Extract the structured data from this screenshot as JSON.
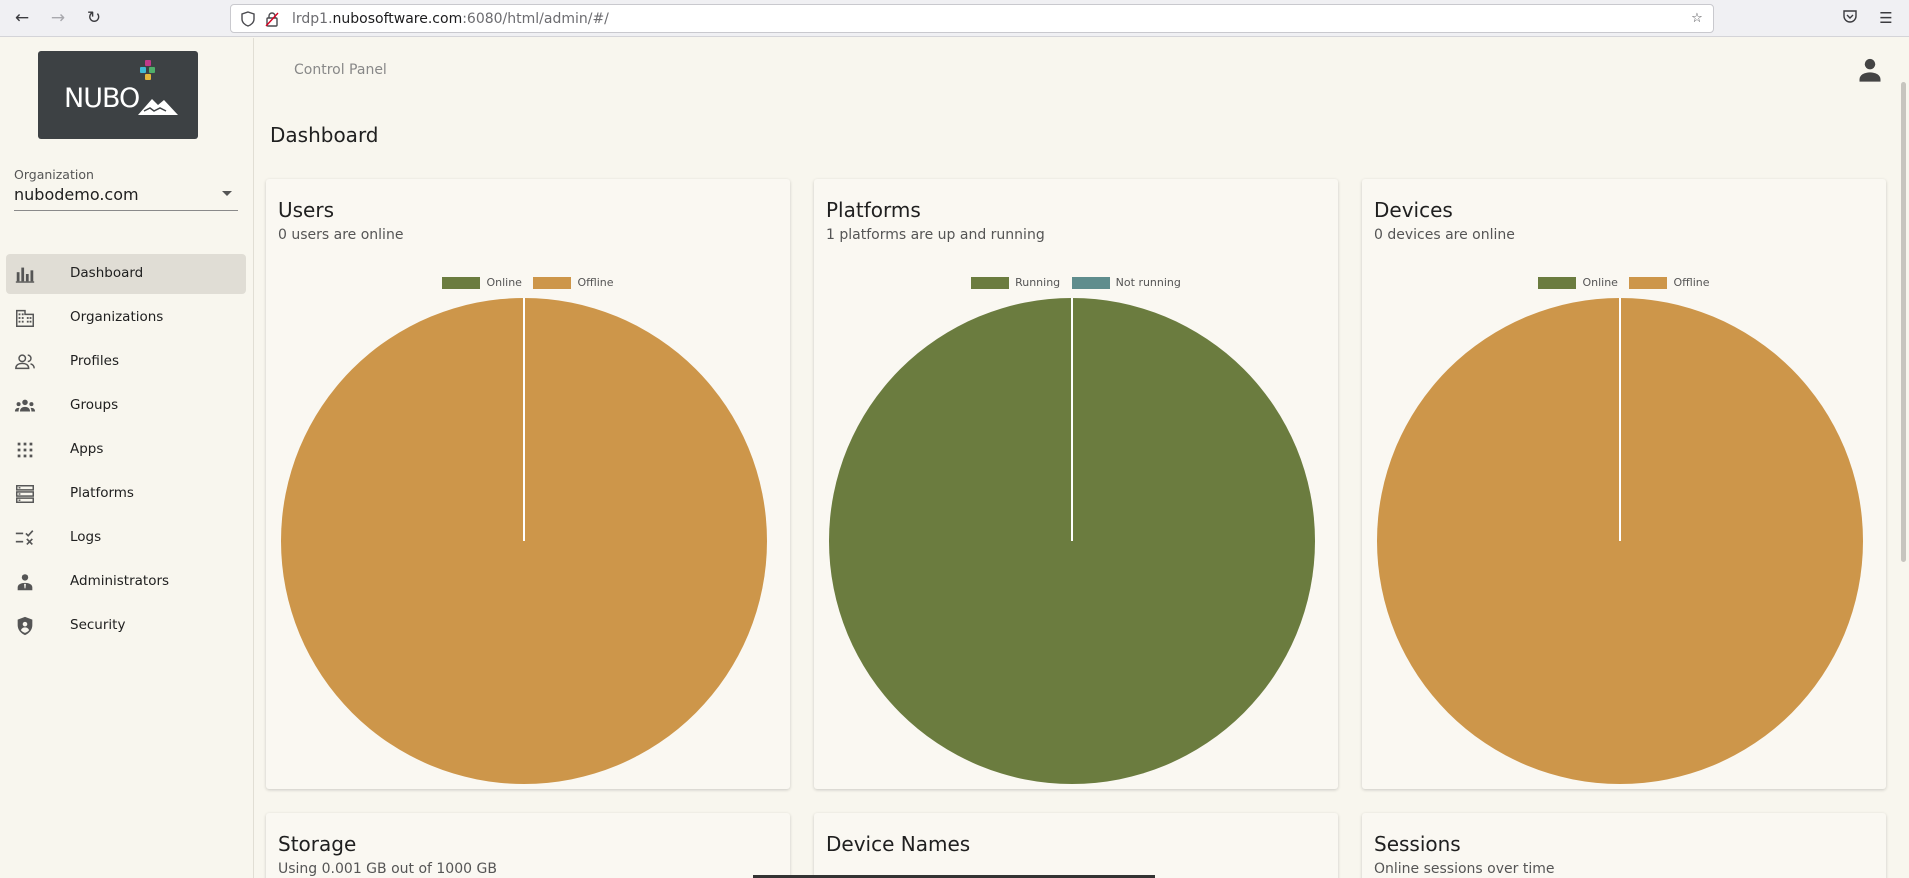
{
  "browser": {
    "url_host_prefix": "lrdp1.",
    "url_host": "nubosoftware.com",
    "url_rest": ":6080/html/admin/#/"
  },
  "sidebar": {
    "logo_text": "NUBO",
    "org_label": "Organization",
    "org_value": "nubodemo.com",
    "items": [
      {
        "label": "Dashboard",
        "icon": "bar-chart-icon",
        "active": true
      },
      {
        "label": "Organizations",
        "icon": "building-icon"
      },
      {
        "label": "Profiles",
        "icon": "people-icon"
      },
      {
        "label": "Groups",
        "icon": "groups-icon"
      },
      {
        "label": "Apps",
        "icon": "apps-grid-icon"
      },
      {
        "label": "Platforms",
        "icon": "storage-icon"
      },
      {
        "label": "Logs",
        "icon": "rule-icon"
      },
      {
        "label": "Administrators",
        "icon": "admin-icon"
      },
      {
        "label": "Security",
        "icon": "shield-icon"
      }
    ]
  },
  "header": {
    "title": "Control Panel",
    "account_icon": "account-icon"
  },
  "main": {
    "page_title": "Dashboard",
    "cards": [
      {
        "title": "Users",
        "subtitle": "0 users are online",
        "legend": [
          "Online",
          "Offline"
        ]
      },
      {
        "title": "Platforms",
        "subtitle": "1 platforms are up and running",
        "legend": [
          "Running",
          "Not running"
        ]
      },
      {
        "title": "Devices",
        "subtitle": "0 devices are online",
        "legend": [
          "Online",
          "Offline"
        ]
      },
      {
        "title": "Storage",
        "subtitle": "Using 0.001 GB out of 1000 GB"
      },
      {
        "title": "Device Names",
        "subtitle": ""
      },
      {
        "title": "Sessions",
        "subtitle": "Online sessions over time"
      }
    ]
  },
  "colors": {
    "online": "#6b7c3f",
    "offline": "#cd964a",
    "not_running": "#5f8d8d"
  },
  "chart_data": [
    {
      "type": "pie",
      "categories": [
        "Online",
        "Offline"
      ],
      "values": [
        0,
        1
      ]
    },
    {
      "type": "pie",
      "categories": [
        "Running",
        "Not running"
      ],
      "values": [
        1,
        0
      ]
    },
    {
      "type": "pie",
      "categories": [
        "Online",
        "Offline"
      ],
      "values": [
        0,
        1
      ]
    }
  ]
}
